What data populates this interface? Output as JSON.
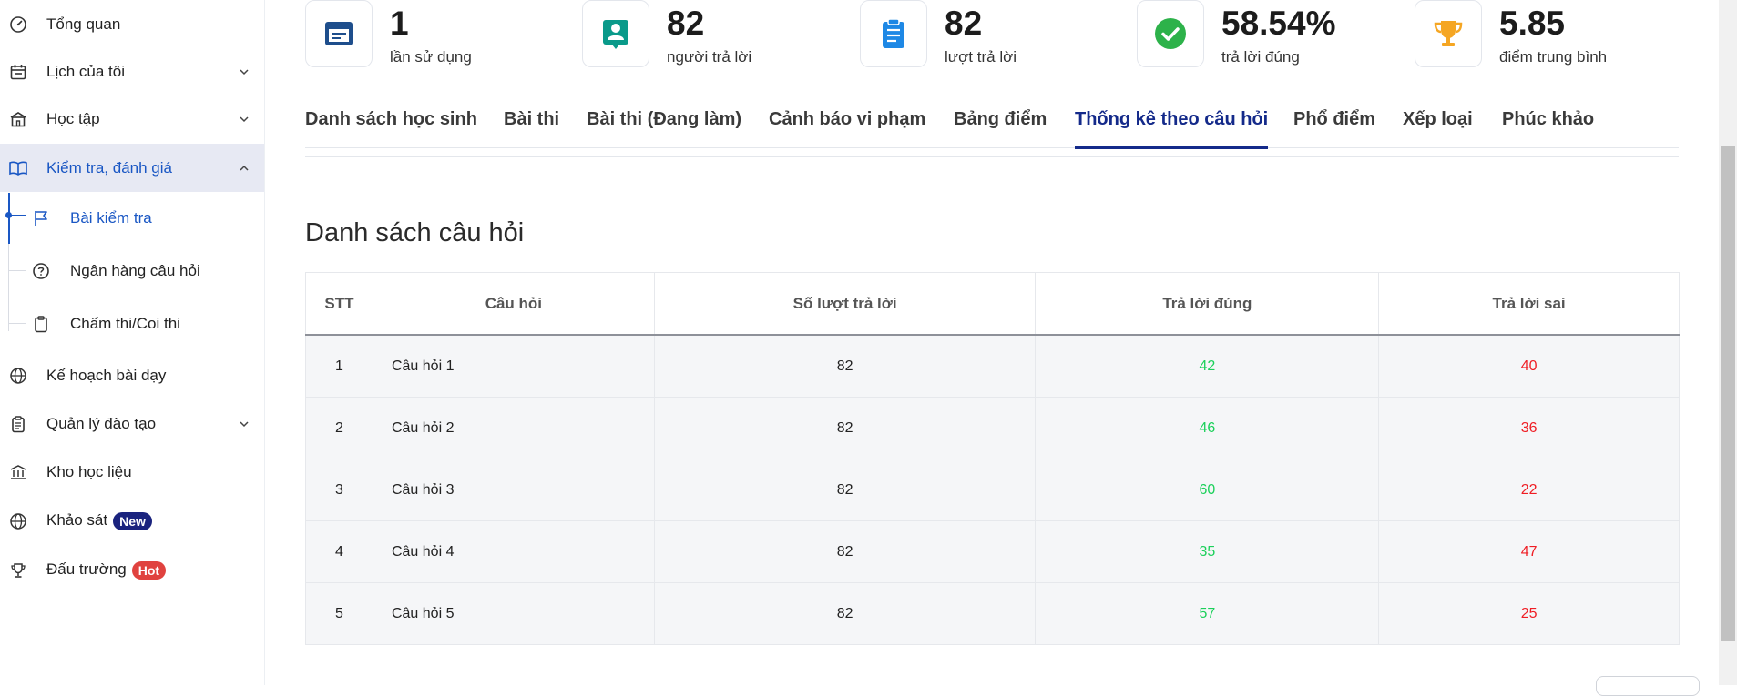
{
  "sidebar": {
    "items": [
      {
        "label": "Tổng quan",
        "icon": "dashboard-gauge-icon"
      },
      {
        "label": "Lịch của tôi",
        "icon": "calendar-icon",
        "expandable": true
      },
      {
        "label": "Học tập",
        "icon": "school-building-icon",
        "expandable": true
      },
      {
        "label": "Kiểm tra, đánh giá",
        "icon": "open-book-icon",
        "expandable": true,
        "expanded": true,
        "active": true
      },
      {
        "label": "Kế hoạch bài dạy",
        "icon": "globe-icon"
      },
      {
        "label": "Quản lý đào tạo",
        "icon": "clipboard-list-icon",
        "expandable": true
      },
      {
        "label": "Kho học liệu",
        "icon": "library-icon"
      },
      {
        "label": "Khảo sát",
        "icon": "globe-icon",
        "badge": "New",
        "badge_color": "#1a237e"
      },
      {
        "label": "Đấu trường",
        "icon": "trophy-icon",
        "badge": "Hot",
        "badge_color": "#e0423f"
      }
    ],
    "sub_items": [
      {
        "label": "Bài kiểm tra",
        "icon": "flag-icon",
        "active": true
      },
      {
        "label": "Ngân hàng câu hỏi",
        "icon": "question-circle-icon"
      },
      {
        "label": "Chấm thi/Coi thi",
        "icon": "clipboard-icon"
      }
    ]
  },
  "stats": [
    {
      "value": "1",
      "label": "lần sử dụng",
      "icon": "form-icon",
      "color": "#1e4e8c"
    },
    {
      "value": "82",
      "label": "người trả lời",
      "icon": "user-card-icon",
      "color": "#0a9a8a"
    },
    {
      "value": "82",
      "label": "lượt trả lời",
      "icon": "clipboard-list-icon",
      "color": "#1e88e5"
    },
    {
      "value": "58.54%",
      "label": "trả lời đúng",
      "icon": "check-circle-icon",
      "color": "#2db24a"
    },
    {
      "value": "5.85",
      "label": "điểm trung bình",
      "icon": "trophy-icon",
      "color": "#f5a623"
    }
  ],
  "tabs": [
    {
      "label": "Danh sách học sinh"
    },
    {
      "label": "Bài thi"
    },
    {
      "label": "Bài thi (Đang làm)"
    },
    {
      "label": "Cảnh báo vi phạm"
    },
    {
      "label": "Bảng điểm"
    },
    {
      "label": "Thống kê theo câu hỏi",
      "active": true
    },
    {
      "label": "Phổ điểm"
    },
    {
      "label": "Xếp loại"
    },
    {
      "label": "Phúc khảo"
    }
  ],
  "section_title": "Danh sách câu hỏi",
  "table": {
    "headers": [
      "STT",
      "Câu hỏi",
      "Số lượt trả lời",
      "Trả lời đúng",
      "Trả lời sai"
    ],
    "rows": [
      [
        "1",
        "Câu hỏi 1",
        "82",
        "42",
        "40"
      ],
      [
        "2",
        "Câu hỏi 2",
        "82",
        "46",
        "36"
      ],
      [
        "3",
        "Câu hỏi 3",
        "82",
        "60",
        "22"
      ],
      [
        "4",
        "Câu hỏi 4",
        "82",
        "35",
        "47"
      ],
      [
        "5",
        "Câu hỏi 5",
        "82",
        "57",
        "25"
      ]
    ]
  },
  "colors": {
    "accent": "#1a57c4",
    "active_tab": "#142a8a",
    "correct": "#1bd05a",
    "wrong": "#ef1d24",
    "active_nav_bg": "#e7e9f3"
  }
}
